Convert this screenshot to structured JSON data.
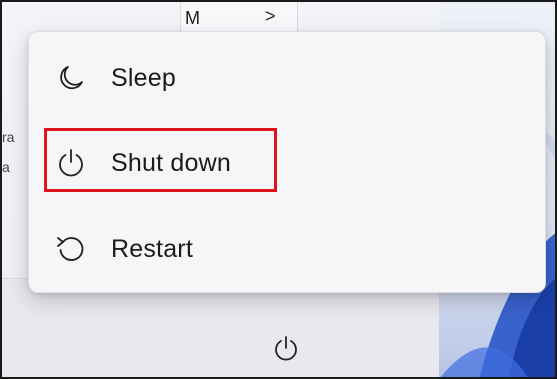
{
  "background": {
    "top_strip_label": "M",
    "top_strip_chevron": ">",
    "left_partial_lines": [
      "ra",
      "a"
    ]
  },
  "power_menu": {
    "items": [
      {
        "label": "Sleep",
        "icon": "moon-icon"
      },
      {
        "label": "Shut down",
        "icon": "power-icon"
      },
      {
        "label": "Restart",
        "icon": "restart-icon"
      }
    ],
    "highlighted_item": "Shut down",
    "highlight_color": "#e0141c"
  },
  "taskbar": {
    "power_icon": "power-icon"
  }
}
